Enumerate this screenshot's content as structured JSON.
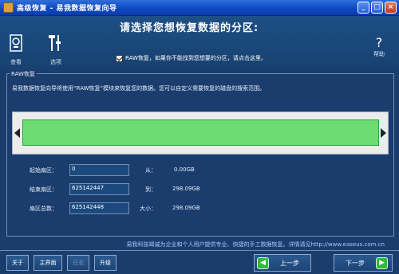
{
  "window": {
    "title": "高级恢复  -  易我数据恢复向导",
    "min_label": "_",
    "max_label": "□",
    "close_label": "×"
  },
  "header": {
    "title": "请选择您想恢复数据的分区:",
    "tools": [
      {
        "label": "查看",
        "icon": "view-icon"
      },
      {
        "label": "选项",
        "icon": "options-icon"
      }
    ],
    "help_label": "帮助",
    "help_glyph": "?",
    "raw_checkbox": {
      "checked": true,
      "label": "RAW恢复，如果你不能找到您想要的分区，请点击这里。"
    }
  },
  "group": {
    "label": "RAW恢复",
    "description": "易我数据恢复向导将使用“RAW恢复”模块来恢复您的数据。您可以自定义需要恢复的磁盘的搜索范围。",
    "range_fraction": 1.0
  },
  "fields": {
    "start_label": "起始扇区：",
    "start_value": "0",
    "end_label": "结束扇区：",
    "end_value": "625142447",
    "total_label": "扇区总数：",
    "total_value": "625142448",
    "from_label": "从：",
    "from_value": "0.00GB",
    "to_label": "到：",
    "to_value": "298.09GB",
    "size_label": "大小：",
    "size_value": "298.09GB"
  },
  "footer": {
    "ad_text": "易我科技竭诚为企业和个人用户提供专业、快捷的手工数据恢复。详情请见http://www.easeus.com.cn",
    "about_label": "关于",
    "home_label": "主界面",
    "log_label": "日志",
    "upgrade_label": "升级",
    "prev_label": "上一步",
    "next_label": "下一步"
  },
  "colors": {
    "background": "#1a3d6e",
    "bar_fill": "#6ddc72",
    "title_bar": "#0c47c4"
  }
}
